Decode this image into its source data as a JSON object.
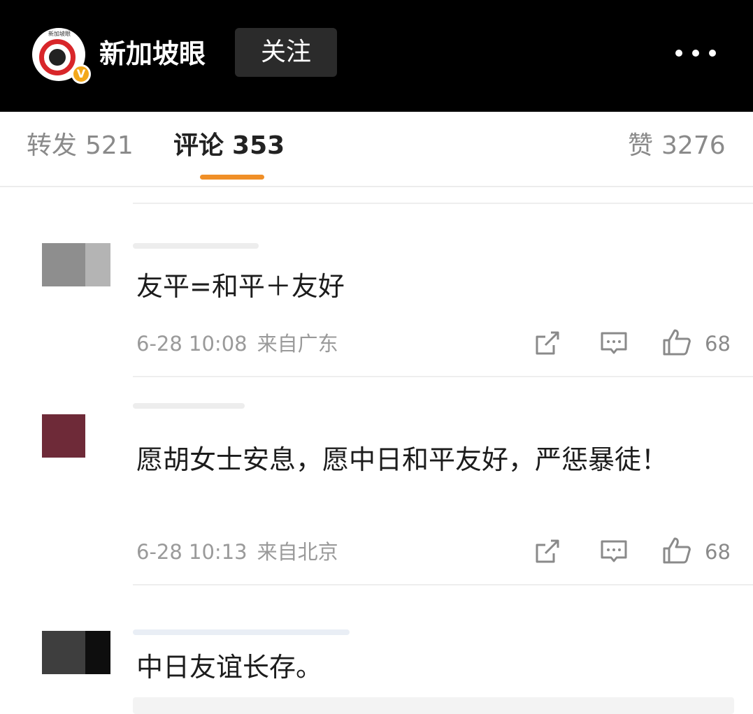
{
  "header": {
    "account_name": "新加坡眼",
    "avatar_mini_text": "新加坡眼",
    "verified_badge": "V",
    "follow_label": "关注",
    "more_icon": "more-dots-icon"
  },
  "tabs": [
    {
      "label": "转发",
      "count": "521",
      "active": false
    },
    {
      "label": "评论",
      "count": "353",
      "active": true
    },
    {
      "label": "赞",
      "count": "3276",
      "active": false
    }
  ],
  "comments": [
    {
      "text": "友平=和平＋友好",
      "time": "6-28 10:08",
      "location": "来自广东",
      "likes": "68"
    },
    {
      "text": "愿胡女士安息，愿中日和平友好，严惩暴徒！",
      "time": "6-28 10:13",
      "location": "来自北京",
      "likes": "68"
    },
    {
      "text": "中日友谊长存。"
    }
  ],
  "colors": {
    "header_bg": "#000000",
    "accent": "#f08f27",
    "verified": "#f3a81b",
    "brand_red": "#d8262a"
  }
}
